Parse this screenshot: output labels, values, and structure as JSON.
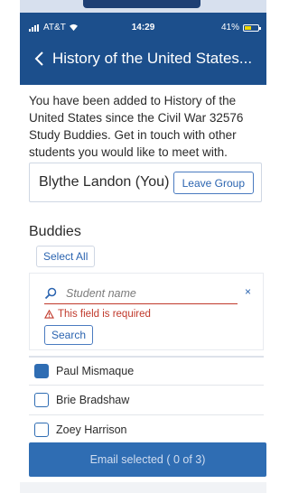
{
  "status": {
    "carrier": "AT&T",
    "time": "14:29",
    "battery": "41%",
    "battery_level": 0.41
  },
  "header": {
    "back_icon": "chevron-left-icon",
    "title": "History of the United States..."
  },
  "intro_text": "You have been added to History of the United States since the Civil War 32576 Study Buddies. Get in touch with other students you would like to meet with.",
  "me": {
    "name": "Blythe Landon (You)",
    "leave_label": "Leave Group"
  },
  "buddies": {
    "heading": "Buddies",
    "select_all_label": "Select All"
  },
  "search": {
    "icon": "search-icon",
    "placeholder": "Student name",
    "value": "",
    "clear_label": "×",
    "error_icon": "warning-icon",
    "error_text": "This field is required",
    "button_label": "Search"
  },
  "students": [
    {
      "name": "Paul Mismaque",
      "checked": true
    },
    {
      "name": "Brie Bradshaw",
      "checked": false
    },
    {
      "name": "Zoey Harrison",
      "checked": false
    }
  ],
  "footer": {
    "email_label": "Email selected ( 0 of 3)"
  },
  "colors": {
    "header_bg": "#1c4f8c",
    "accent": "#2f6db3",
    "error": "#c0392b",
    "battery_fill": "#f1d600"
  }
}
